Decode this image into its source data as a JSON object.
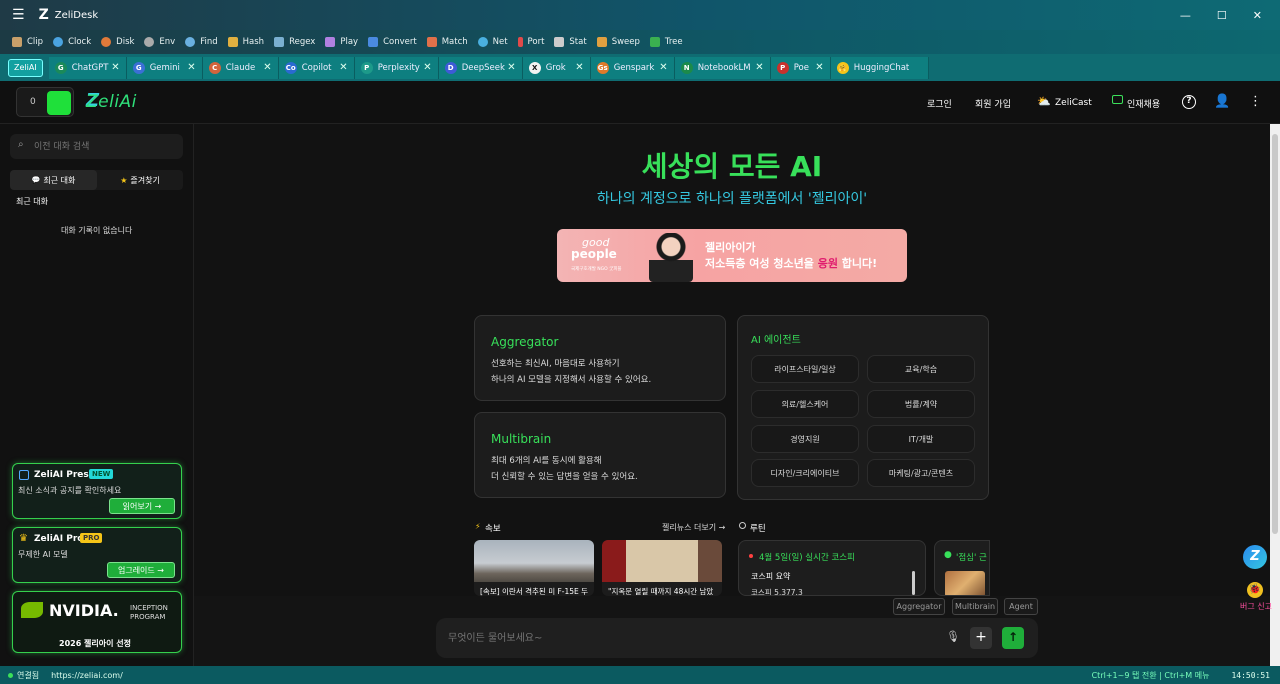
{
  "window": {
    "title": "ZeliDesk"
  },
  "toolbar": [
    "Clip",
    "Clock",
    "Disk",
    "Env",
    "Find",
    "Hash",
    "Regex",
    "Play",
    "Convert",
    "Match",
    "Net",
    "Port",
    "Stat",
    "Sweep",
    "Tree"
  ],
  "tabs": {
    "active": "ZeliAI",
    "items": [
      {
        "label": "ChatGPT",
        "letter": "G",
        "color": "#1a8a5a"
      },
      {
        "label": "Gemini",
        "letter": "G",
        "color": "#3b6fd6"
      },
      {
        "label": "Claude",
        "letter": "C",
        "color": "#d2643c"
      },
      {
        "label": "Copilot",
        "letter": "Co",
        "color": "#2a6ad1"
      },
      {
        "label": "Perplexity",
        "letter": "P",
        "color": "#1d9a8a"
      },
      {
        "label": "DeepSeek",
        "letter": "D",
        "color": "#3e5bd6"
      },
      {
        "label": "Grok",
        "letter": "X",
        "color": "#f2f2f2"
      },
      {
        "label": "Genspark",
        "letter": "Gs",
        "color": "#e07a2a"
      },
      {
        "label": "NotebookLM",
        "letter": "N",
        "color": "#1c8a4a"
      },
      {
        "label": "Poe",
        "letter": "P",
        "color": "#c8322d"
      },
      {
        "label": "HuggingChat",
        "letter": "🤗",
        "color": "#f5c518"
      }
    ]
  },
  "header": {
    "counter": "0",
    "logo": "ZeliAi",
    "nav": {
      "login": "로그인",
      "signup": "회원 가입",
      "zelicast": "ZeliCast",
      "jobs": "인재채용"
    }
  },
  "sidebar": {
    "search_placeholder": "이전 대화 검색",
    "tabs": {
      "recent": "최근 대화",
      "favorites": "즐겨찾기"
    },
    "section_title": "최근 대화",
    "empty": "대화 기록이 없습니다",
    "press": {
      "title": "ZeliAI Press",
      "badge": "NEW",
      "desc": "최신 소식과 공지를 확인하세요",
      "button": "읽어보기 →"
    },
    "pro": {
      "title": "ZeliAI Pro",
      "badge": "PRO",
      "desc": "무제한 AI 모델",
      "button": "업그레이드 →"
    },
    "nvidia": {
      "brand": "NVIDIA.",
      "program_line1": "INCEPTION",
      "program_line2": "PROGRAM",
      "caption": "2026 젤리아이 선정"
    }
  },
  "hero": {
    "title": "세상의 모든 AI",
    "subtitle": "하나의 계정으로 하나의 플랫폼에서 '젤리아이'"
  },
  "banner": {
    "logo_line1": "good",
    "logo_line2": "people",
    "tagline": "국제구호개발 NGO 굿피플",
    "line1": "젤리아이가",
    "line2_prefix": "저소득층 여성 청소년을 ",
    "line2_highlight": "응원",
    "line2_suffix": " 합니다!"
  },
  "aggregator": {
    "title": "Aggregator",
    "line1": "선호하는 최신AI, 마음대로 사용하기",
    "line2": "하나의 AI 모델을 지정해서 사용할 수 있어요."
  },
  "multibrain": {
    "title": "Multibrain",
    "line1": "최대 6개의 AI를 동시에 활용해",
    "line2": "더 신뢰할 수 있는 답변을 얻을 수 있어요."
  },
  "agents": {
    "title": "AI 에이전트",
    "items": [
      "라이프스타일/일상",
      "교육/학습",
      "의료/헬스케어",
      "법률/계약",
      "경영지원",
      "IT/개발",
      "디자인/크리에이티브",
      "마케팅/광고/콘텐츠"
    ]
  },
  "news": {
    "title": "속보",
    "more": "젤리뉴스 더보기 →",
    "items": [
      "[속보] 이란서 격추된 미 F-15E 두",
      "\"지옥문 열릴 때까지 48시간 남았"
    ]
  },
  "routine": {
    "title": "루틴",
    "card1": {
      "title": "4월 5일(일) 실시간 코스피",
      "sub": "코스피 요약",
      "value": "코스피 5,377.3"
    },
    "card2": {
      "title": "'점심' 근"
    }
  },
  "modes": [
    "Aggregator",
    "Multibrain",
    "Agent"
  ],
  "input": {
    "placeholder": "무엇이든 물어보세요~"
  },
  "bug_report": "버그 신고",
  "status": {
    "connected": "연결됨",
    "url": "https://zeliai.com/",
    "hint": "Ctrl+1~9 탭 전환 | Ctrl+M 메뉴",
    "time": "14:50:51"
  },
  "colors": {
    "accent": "#38e05a",
    "teal": "#0f6c72",
    "cyan": "#35c8e0"
  }
}
